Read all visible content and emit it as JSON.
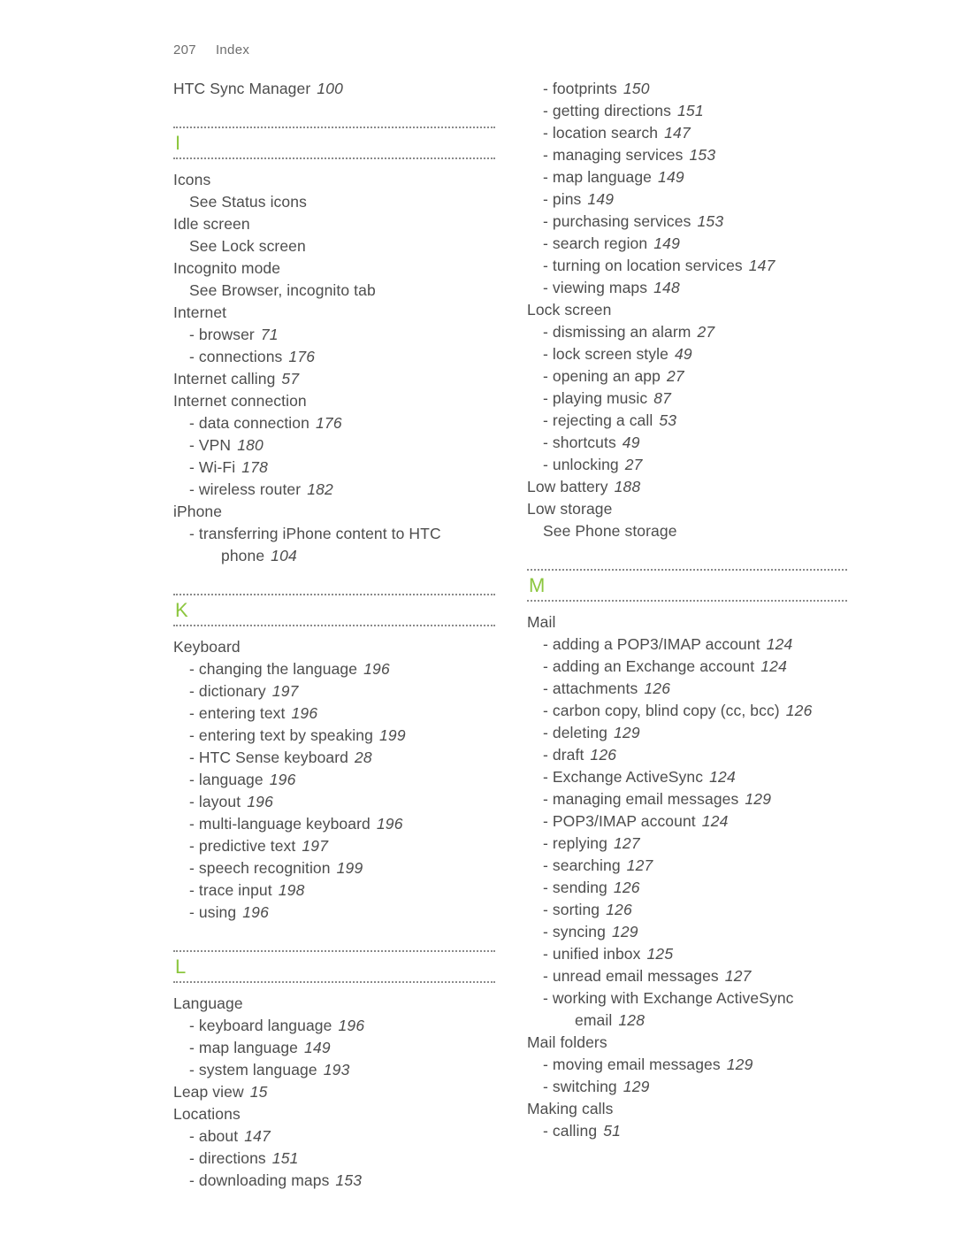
{
  "page": {
    "folio_number": "207",
    "folio_title": "Index"
  },
  "accent_color": "#8cc63e",
  "text_color": "#4d4d4d",
  "left_column": {
    "lead_entries": [
      {
        "kind": "main",
        "label": "HTC Sync Manager",
        "page": "100"
      }
    ],
    "sections": [
      {
        "letter": "I",
        "entries": [
          {
            "kind": "main",
            "label": "Icons",
            "page": ""
          },
          {
            "kind": "see",
            "label": "See Status icons",
            "page": ""
          },
          {
            "kind": "main",
            "label": "Idle screen",
            "page": ""
          },
          {
            "kind": "see",
            "label": "See Lock screen",
            "page": ""
          },
          {
            "kind": "main",
            "label": "Incognito mode",
            "page": ""
          },
          {
            "kind": "see",
            "label": "See Browser, incognito tab",
            "page": ""
          },
          {
            "kind": "main",
            "label": "Internet",
            "page": ""
          },
          {
            "kind": "sub",
            "label": "- browser",
            "page": "71"
          },
          {
            "kind": "sub",
            "label": "- connections",
            "page": "176"
          },
          {
            "kind": "main",
            "label": "Internet calling",
            "page": "57"
          },
          {
            "kind": "main",
            "label": "Internet connection",
            "page": ""
          },
          {
            "kind": "sub",
            "label": "- data connection",
            "page": "176"
          },
          {
            "kind": "sub",
            "label": "- VPN",
            "page": "180"
          },
          {
            "kind": "sub",
            "label": "- Wi-Fi",
            "page": "178"
          },
          {
            "kind": "sub",
            "label": "- wireless router",
            "page": "182"
          },
          {
            "kind": "main",
            "label": "iPhone",
            "page": ""
          },
          {
            "kind": "sub",
            "label": "- transferring iPhone content to HTC",
            "page": ""
          },
          {
            "kind": "cont",
            "label": "phone",
            "page": "104"
          }
        ]
      },
      {
        "letter": "K",
        "entries": [
          {
            "kind": "main",
            "label": "Keyboard",
            "page": ""
          },
          {
            "kind": "sub",
            "label": "- changing the language",
            "page": "196"
          },
          {
            "kind": "sub",
            "label": "- dictionary",
            "page": "197"
          },
          {
            "kind": "sub",
            "label": "- entering text",
            "page": "196"
          },
          {
            "kind": "sub",
            "label": "- entering text by speaking",
            "page": "199"
          },
          {
            "kind": "sub",
            "label": "- HTC Sense keyboard",
            "page": "28"
          },
          {
            "kind": "sub",
            "label": "- language",
            "page": "196"
          },
          {
            "kind": "sub",
            "label": "- layout",
            "page": "196"
          },
          {
            "kind": "sub",
            "label": "- multi-language keyboard",
            "page": "196"
          },
          {
            "kind": "sub",
            "label": "- predictive text",
            "page": "197"
          },
          {
            "kind": "sub",
            "label": "- speech recognition",
            "page": "199"
          },
          {
            "kind": "sub",
            "label": "- trace input",
            "page": "198"
          },
          {
            "kind": "sub",
            "label": "- using",
            "page": "196"
          }
        ]
      },
      {
        "letter": "L",
        "entries": [
          {
            "kind": "main",
            "label": "Language",
            "page": ""
          },
          {
            "kind": "sub",
            "label": "- keyboard language",
            "page": "196"
          },
          {
            "kind": "sub",
            "label": "- map language",
            "page": "149"
          },
          {
            "kind": "sub",
            "label": "- system language",
            "page": "193"
          },
          {
            "kind": "main",
            "label": "Leap view",
            "page": "15"
          },
          {
            "kind": "main",
            "label": "Locations",
            "page": ""
          },
          {
            "kind": "sub",
            "label": "- about",
            "page": "147"
          },
          {
            "kind": "sub",
            "label": "- directions",
            "page": "151"
          },
          {
            "kind": "sub",
            "label": "- downloading maps",
            "page": "153"
          }
        ]
      }
    ]
  },
  "right_column": {
    "lead_entries": [
      {
        "kind": "sub",
        "label": "- footprints",
        "page": "150"
      },
      {
        "kind": "sub",
        "label": "- getting directions",
        "page": "151"
      },
      {
        "kind": "sub",
        "label": "- location search",
        "page": "147"
      },
      {
        "kind": "sub",
        "label": "- managing services",
        "page": "153"
      },
      {
        "kind": "sub",
        "label": "- map language",
        "page": "149"
      },
      {
        "kind": "sub",
        "label": "- pins",
        "page": "149"
      },
      {
        "kind": "sub",
        "label": "- purchasing services",
        "page": "153"
      },
      {
        "kind": "sub",
        "label": "- search region",
        "page": "149"
      },
      {
        "kind": "sub",
        "label": "- turning on location services",
        "page": "147"
      },
      {
        "kind": "sub",
        "label": "- viewing maps",
        "page": "148"
      },
      {
        "kind": "main",
        "label": "Lock screen",
        "page": ""
      },
      {
        "kind": "sub",
        "label": "- dismissing an alarm",
        "page": "27"
      },
      {
        "kind": "sub",
        "label": "- lock screen style",
        "page": "49"
      },
      {
        "kind": "sub",
        "label": "- opening an app",
        "page": "27"
      },
      {
        "kind": "sub",
        "label": "- playing music",
        "page": "87"
      },
      {
        "kind": "sub",
        "label": "- rejecting a call",
        "page": "53"
      },
      {
        "kind": "sub",
        "label": "- shortcuts",
        "page": "49"
      },
      {
        "kind": "sub",
        "label": "- unlocking",
        "page": "27"
      },
      {
        "kind": "main",
        "label": "Low battery",
        "page": "188"
      },
      {
        "kind": "main",
        "label": "Low storage",
        "page": ""
      },
      {
        "kind": "see",
        "label": "See Phone storage",
        "page": ""
      }
    ],
    "sections": [
      {
        "letter": "M",
        "entries": [
          {
            "kind": "main",
            "label": "Mail",
            "page": ""
          },
          {
            "kind": "sub",
            "label": "- adding a POP3/IMAP account",
            "page": "124"
          },
          {
            "kind": "sub",
            "label": "- adding an Exchange account",
            "page": "124"
          },
          {
            "kind": "sub",
            "label": "- attachments",
            "page": "126"
          },
          {
            "kind": "sub",
            "label": "- carbon copy, blind copy (cc, bcc)",
            "page": "126"
          },
          {
            "kind": "sub",
            "label": "- deleting",
            "page": "129"
          },
          {
            "kind": "sub",
            "label": "- draft",
            "page": "126"
          },
          {
            "kind": "sub",
            "label": "- Exchange ActiveSync",
            "page": "124"
          },
          {
            "kind": "sub",
            "label": "- managing email messages",
            "page": "129"
          },
          {
            "kind": "sub",
            "label": "- POP3/IMAP account",
            "page": "124"
          },
          {
            "kind": "sub",
            "label": "- replying",
            "page": "127"
          },
          {
            "kind": "sub",
            "label": "- searching",
            "page": "127"
          },
          {
            "kind": "sub",
            "label": "- sending",
            "page": "126"
          },
          {
            "kind": "sub",
            "label": "- sorting",
            "page": "126"
          },
          {
            "kind": "sub",
            "label": "- syncing",
            "page": "129"
          },
          {
            "kind": "sub",
            "label": "- unified inbox",
            "page": "125"
          },
          {
            "kind": "sub",
            "label": "- unread email messages",
            "page": "127"
          },
          {
            "kind": "sub",
            "label": "- working with Exchange ActiveSync",
            "page": ""
          },
          {
            "kind": "cont",
            "label": "email",
            "page": "128"
          },
          {
            "kind": "main",
            "label": "Mail folders",
            "page": ""
          },
          {
            "kind": "sub",
            "label": "- moving email messages",
            "page": "129"
          },
          {
            "kind": "sub",
            "label": "- switching",
            "page": "129"
          },
          {
            "kind": "main",
            "label": "Making calls",
            "page": ""
          },
          {
            "kind": "sub",
            "label": "- calling",
            "page": "51"
          }
        ]
      }
    ]
  }
}
